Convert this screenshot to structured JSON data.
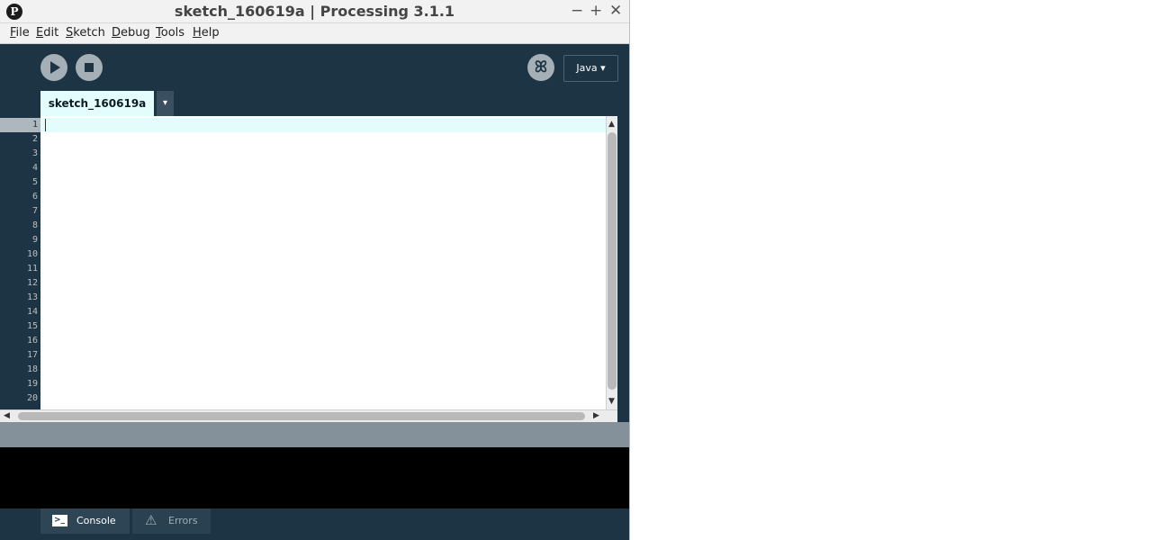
{
  "window": {
    "title": "sketch_160619a | Processing 3.1.1",
    "logo_glyph": "P",
    "controls": {
      "minimize": "−",
      "maximize": "+",
      "close": "✕"
    }
  },
  "menu": [
    {
      "label": "File",
      "mnemonic": "F"
    },
    {
      "label": "Edit",
      "mnemonic": "E"
    },
    {
      "label": "Sketch",
      "mnemonic": "S"
    },
    {
      "label": "Debug",
      "mnemonic": "D"
    },
    {
      "label": "Tools",
      "mnemonic": "T"
    },
    {
      "label": "Help",
      "mnemonic": "H"
    }
  ],
  "toolbar": {
    "run_icon": "play-icon",
    "stop_icon": "stop-icon",
    "debugger_icon": "bug-icon",
    "debugger_glyph": "ꕤ",
    "mode_label": "Java ▾"
  },
  "tabs": {
    "active_label": "sketch_160619a",
    "menu_glyph": "▾"
  },
  "editor": {
    "line_numbers": [
      "1",
      "2",
      "3",
      "4",
      "5",
      "6",
      "7",
      "8",
      "9",
      "10",
      "11",
      "12",
      "13",
      "14",
      "15",
      "16",
      "17",
      "18",
      "19",
      "20"
    ],
    "current_line": 1,
    "content": ""
  },
  "scrollbars": {
    "up": "▲",
    "down": "▼",
    "left": "◀",
    "right": "▶"
  },
  "footer": {
    "console_label": "Console",
    "console_glyph": ">_",
    "errors_label": "Errors",
    "errors_glyph": "⚠"
  },
  "colors": {
    "editor_bg": "#1d3445",
    "current_line": "#e3fdfd",
    "status_bar": "#84919a",
    "console_bg": "#000000",
    "button": "#a5afb6"
  }
}
